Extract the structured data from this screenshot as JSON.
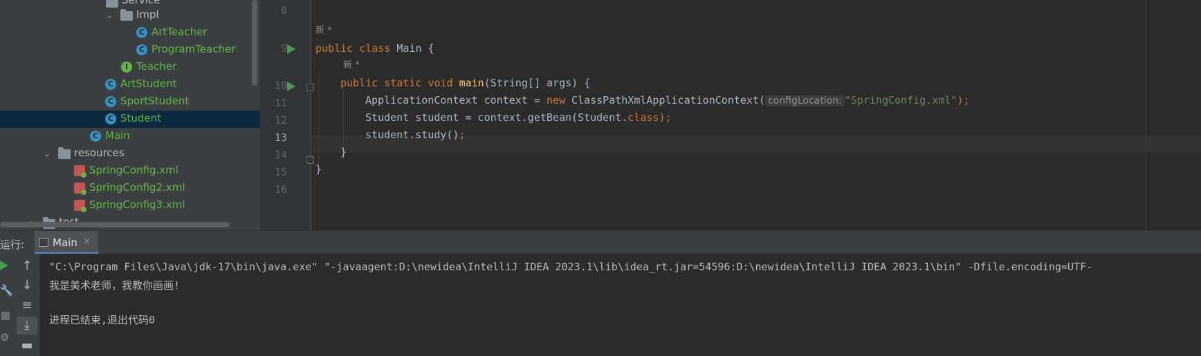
{
  "project_tree": {
    "items": [
      {
        "label": "Service",
        "kind": "folder"
      },
      {
        "label": "Impl",
        "kind": "package"
      },
      {
        "label": "ArtTeacher",
        "kind": "class"
      },
      {
        "label": "ProgramTeacher",
        "kind": "class"
      },
      {
        "label": "Teacher",
        "kind": "interface"
      },
      {
        "label": "ArtStudent",
        "kind": "class"
      },
      {
        "label": "SportStudent",
        "kind": "class"
      },
      {
        "label": "Student",
        "kind": "class",
        "selected": true
      },
      {
        "label": "Main",
        "kind": "main-class"
      },
      {
        "label": "resources",
        "kind": "resources-folder"
      },
      {
        "label": "SpringConfig.xml",
        "kind": "spring-xml"
      },
      {
        "label": "SpringConfig2.xml",
        "kind": "spring-xml"
      },
      {
        "label": "SpringConfig3.xml",
        "kind": "spring-xml"
      },
      {
        "label": "test",
        "kind": "folder"
      }
    ],
    "class_icon_glyph": "C",
    "interface_icon_glyph": "I"
  },
  "editor": {
    "line_numbers": [
      "8",
      "9",
      "10",
      "11",
      "12",
      "13",
      "14",
      "15",
      "16"
    ],
    "current_line": "13",
    "author_hint": "新 *",
    "code": {
      "l9_kw": "public class",
      "l9_rest": " Main {",
      "l10_kw": "public static void",
      "l10_fn": "main",
      "l10_rest": "(String[] args) {",
      "l11_a": "ApplicationContext context = ",
      "l11_kw": "new",
      "l11_b": " ClassPathXmlApplicationContext(",
      "l11_hint": "configLocation:",
      "l11_str": "\"SpringConfig.xml\"",
      "l11_end": ");",
      "l12_a": "Student student = context.getBean(Student.",
      "l12_kw": "class",
      "l12_end": ");",
      "l13_a": "student.study()",
      "l13_end": ";",
      "l14": "}",
      "l15": "}"
    }
  },
  "run_panel": {
    "label": "运行:",
    "tab_label": "Main",
    "tab_close": "×",
    "console_lines": [
      "\"C:\\Program Files\\Java\\jdk-17\\bin\\java.exe\" \"-javaagent:D:\\newidea\\IntelliJ IDEA 2023.1\\lib\\idea_rt.jar=54596:D:\\newidea\\IntelliJ IDEA 2023.1\\bin\" -Dfile.encoding=UTF-",
      "我是美术老师，我教你画画!",
      "",
      "进程已结束,退出代码0"
    ],
    "tools": [
      "arrow-up",
      "arrow-down",
      "soft-wrap",
      "scroll-to-end",
      "print"
    ]
  },
  "colors": {
    "accent_blue": "#4a88c7",
    "run_green": "#499c54",
    "keyword": "#cc7832",
    "function": "#ffc66d",
    "string": "#6a8759"
  }
}
